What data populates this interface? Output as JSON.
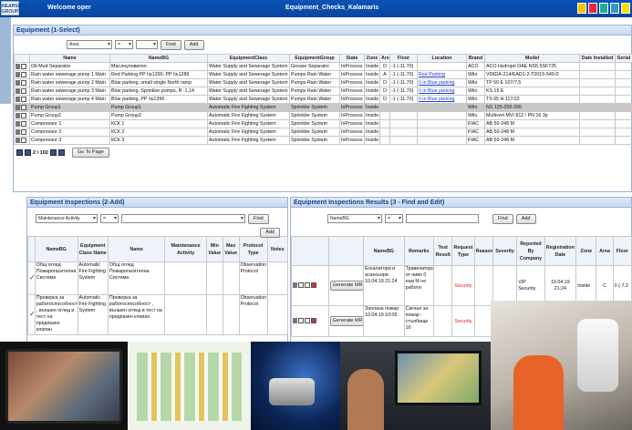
{
  "app": {
    "logo_text": "NEARSOFT GROUP",
    "welcome": "Welcome oper",
    "title": "Equipment_Checks_Kalamaris"
  },
  "toolbar_icons": [
    "home-icon",
    "calendar-icon",
    "chat-icon",
    "grid-icon",
    "help-icon"
  ],
  "equipment": {
    "panel_title": "Equipment (1-Select)",
    "filter": {
      "field": "Area",
      "operator": "=",
      "value": "",
      "find_label": "Find",
      "add_label": "Add"
    },
    "columns": [
      "Name",
      "NameBG",
      "EquipmentClass",
      "EquipmentGroup",
      "State",
      "Zone",
      "Area",
      "Floor",
      "Location",
      "Brand",
      "Model",
      "Date Installed",
      "Serial"
    ],
    "rows": [
      {
        "name": "Oil-Mud Separator",
        "namebg": "Маслоуловител",
        "class": "Water Supply and Sewerage System",
        "group": "Grease Separator",
        "state": "InProcess",
        "zone": "Inside",
        "area": "D",
        "floor": "-1 (-11.70)",
        "location": "",
        "brand": "ACO",
        "model": "ACO Hydrojet OAE NS5.5SF725",
        "date": "",
        "serial": "",
        "shade": false
      },
      {
        "name": "Rain water sewerage pump 1 Main",
        "namebg": "Red Parking PP №1290, PP №1289",
        "class": "Water Supply and Sewerage System",
        "group": "Pumps Rain Water",
        "state": "InProcess",
        "zone": "Inside",
        "area": "A",
        "floor": "-1 (-11.70)",
        "location": "Red Parking",
        "brand": "Wilo",
        "model": "V06DA-214/EAD1-2-T0015-540-0",
        "date": "",
        "serial": "",
        "shade": false
      },
      {
        "name": "Rain water sewerage pump 2 Main",
        "namebg": "Blue parking, small single North ramp",
        "class": "Water Supply and Sewerage System",
        "group": "Pumps Rain Water",
        "state": "InProcess",
        "zone": "Inside",
        "area": "D",
        "floor": "-1 (-11.70)",
        "location": "II in Blue parking",
        "brand": "Wilo",
        "model": "TP 50 E 107/7,5",
        "date": "",
        "serial": "",
        "shade": false
      },
      {
        "name": "Rain water sewerage pump 3 Main",
        "namebg": "Blue parking, Sprinkler pumps, R -1,14",
        "class": "Water Supply and Sewerage System",
        "group": "Pumps Rain Water",
        "state": "InProcess",
        "zone": "Inside",
        "area": "D",
        "floor": "-1 (-11.70)",
        "location": "II in Blue parking",
        "brand": "Wilo",
        "model": "KS 15 E",
        "date": "",
        "serial": "",
        "shade": false
      },
      {
        "name": "Rain water sewerage pump 4 Main",
        "namebg": "Blue parking, PP №1396",
        "class": "Water Supply and Sewerage System",
        "group": "Pumps Rain Water",
        "state": "InProcess",
        "zone": "Inside",
        "area": "D",
        "floor": "-1 (-11.70)",
        "location": "II in Blue parking",
        "brand": "Wilo",
        "model": "TS 65 H 117/22",
        "date": "",
        "serial": "",
        "shade": false
      },
      {
        "name": "Pump Group1",
        "namebg": "Pump Group1",
        "class": "Automatic Fire Fighting System",
        "group": "Sprinkler System",
        "state": "InProcess",
        "zone": "Inside",
        "area": "",
        "floor": "",
        "location": "",
        "brand": "Wilo",
        "model": "NS 125-250-266",
        "date": "",
        "serial": "",
        "shade": true
      },
      {
        "name": "Pump Group2",
        "namebg": "Pump Group2",
        "class": "Automatic Fire Fighting System",
        "group": "Sprinkler System",
        "state": "InProcess",
        "zone": "Inside",
        "area": "",
        "floor": "",
        "location": "",
        "brand": "Wilo",
        "model": "Multivert MVI 812 / PN 16 3p",
        "date": "",
        "serial": "",
        "shade": false
      },
      {
        "name": "Compressor 1",
        "namebg": "КСК 1",
        "class": "Automatic Fire Fighting System",
        "group": "Sprinkler System",
        "state": "InProcess",
        "zone": "Inside",
        "area": "",
        "floor": "",
        "location": "",
        "brand": "FIAC",
        "model": "AB 50-248 M",
        "date": "",
        "serial": "",
        "shade": false
      },
      {
        "name": "Compressor 2",
        "namebg": "КСК 2",
        "class": "Automatic Fire Fighting System",
        "group": "Sprinkler System",
        "state": "InProcess",
        "zone": "Inside",
        "area": "",
        "floor": "",
        "location": "",
        "brand": "FIAC",
        "model": "AB 50-248 M",
        "date": "",
        "serial": "",
        "shade": false
      },
      {
        "name": "Compressor 3",
        "namebg": "КСК 3",
        "class": "Automatic Fire Fighting System",
        "group": "Sprinkler System",
        "state": "InProcess",
        "zone": "Inside",
        "area": "",
        "floor": "",
        "location": "",
        "brand": "FIAC",
        "model": "AB 50-248 M",
        "date": "",
        "serial": "",
        "shade": false
      }
    ],
    "pager": {
      "text": "2 / 102",
      "goto_label": "Go To Page"
    }
  },
  "inspections": {
    "panel_title": "Equipment Inspections (2-Add)",
    "filter": {
      "field": "Maintenance Activity",
      "operator": "=",
      "find_label": "Find",
      "add_label": "Add"
    },
    "columns": [
      "NameBG",
      "Equipment Class Name",
      "Name",
      "Maintenance Activity",
      "Min Value",
      "Max Value",
      "Protocol Type",
      "Notes"
    ],
    "rows": [
      {
        "namebg": "Общ оглед Пожарогасителна Система",
        "class": "Automatic Fire Fighting System",
        "name": "Общ оглед Пожарогасителна Система",
        "activity": "",
        "min": "",
        "max": "",
        "protocol": "Observation Protocol",
        "notes": ""
      },
      {
        "namebg": "Проверка за работоспособност , външен оглед и тест на предпазен клапан",
        "class": "Automatic Fire Fighting System",
        "name": "Проверка за работоспособност , външен оглед и тест на предпазен клапан",
        "activity": "",
        "min": "",
        "max": "",
        "protocol": "Observation Protocol",
        "notes": ""
      }
    ]
  },
  "results": {
    "panel_title": "Equipment Inspections Results (3 - Find and Edit)",
    "filter": {
      "field": "NameBG",
      "operator": "=",
      "find_label": "Find",
      "add_label": "Add"
    },
    "columns": [
      "NameBG",
      "Remarks",
      "Test Result",
      "Request Type",
      "Reason",
      "Severity",
      "Reported By Company",
      "Registration Date",
      "Zone",
      "Area",
      "Floor"
    ],
    "rows": [
      {
        "btn": "Generate MR",
        "namebg": "Ескалатори и асансьори 10.04.19 21:24",
        "remarks": "Травелатора от ниво 0 към М не работи",
        "test": "",
        "request": "Security",
        "reason": "",
        "severity": "",
        "company": "VIP Security",
        "date": "10.04.19 21:24",
        "zone": "Inside",
        "area": "C",
        "floor": "0 (-7.2"
      },
      {
        "btn": "Generate MR",
        "namebg": "Заплаха пожар 10.04.19 10:05",
        "remarks": "Сигнал за пожар - стълбище 16",
        "test": "",
        "request": "Security",
        "reason": "",
        "severity": "",
        "company": "",
        "date": "",
        "zone": "",
        "area": "",
        "floor": ""
      }
    ]
  },
  "photos": [
    "tablet-map",
    "floor-plan",
    "industrial-device",
    "engineer-monitors",
    "worker-robot"
  ],
  "colors": {
    "header": "#0a53b6",
    "panel_title": "#1a3d8f",
    "link": "#1a3fd0",
    "security": "#d22"
  }
}
